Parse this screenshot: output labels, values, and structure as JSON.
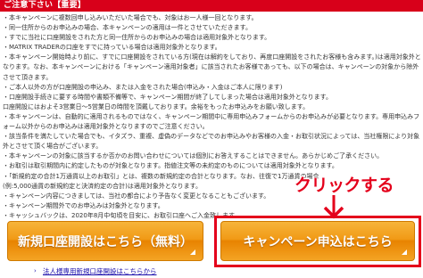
{
  "header": {
    "title": "ご注意下さい【重要】"
  },
  "notes": [
    "・本キャンペーンに複数回申し込みいただいた場合でも、対象はお一人様一回となります。",
    "・同一住所からのお申込みの場合、本キャンペーンの適用は一件とさせていただきます。",
    "・すでに当社に口座開設をされた方と同一住所からのお申込みの場合は適用対象外となります。",
    "・MATRIX TRADERの口座をすでに持っている場合は適用対象外となります。",
    "・本キャンペーン開始時より前に、すでに口座開設をされている方(現在は解約をしており、再度口座開設をされたお客様も含みます。)は適用対象外となります。なお、本キャンペーンにおける「キャンペーン適用対象者」に該当されたお客様であっても、以下の場合は、キャンペーンの対象から除外させて頂きます。",
    "・ご本人以外の方が口座開設の申込み、または入金をされた場合(申込み・入金はご本人に限ります)",
    "・口座開設手続きに要する時間や書類不備等で、キャンペーン期間が終了してしまった場合は適用対象外となります。",
    "口座開設にはおよそ3営業日〜5営業日の時間を頂戴しております。余裕をもったお申込みをお願い致します。",
    "・本キャンペーンは、自動的に適用されるものではなく、キャンペーン期間中に専用申込みフォームからのお申込みが必要となります。専用申込みフォーム以外からのお申込みは適用対象外となりますのでご注意ください。",
    "・該当条件を満たしていた場合でも、イタズラ、重複、虚偽のデータなどでのお申込みやお客様の入金・お取引状況によっては、当社権限により対象外とさせて頂く場合がございます。",
    "・本キャンペーンの対象に該当するか否かのお問い合わせについては個別にお答えすることはできません。あらかじめご了承ください。",
    "・お取引は取引期間内に約定したものが対象となります。指値注文等の未約定のものについては適用対象外となります。",
    "・「新規約定の合計1万通貨以上のお取引」とは、複数の新規約定の合計となります。なお、往復で1万通貨の場合",
    "(例:5,000通貨の新規約定と決済約定の合計)は適用対象外となります。",
    "・キャンペーン内容につきましては、当社の都合により予告なく変更となることもございます。",
    "・キャンペーン期間外でのお申込みは対象外となります。",
    "・キャッシュバックは、2020年8月中旬頃を目安に、お取引口座へご入金致します。"
  ],
  "callout": {
    "text": "クリックする"
  },
  "buttons": {
    "open_account": "新規口座開設はこちら（無料）",
    "apply_campaign": "キャンペーン申込はこちら"
  },
  "links": {
    "corporate": "法人様専用新規口座開設はこちらから"
  },
  "colors": {
    "header_red": "#d8001a",
    "button_orange": "#f19a16",
    "highlight_red": "#e4001b"
  }
}
